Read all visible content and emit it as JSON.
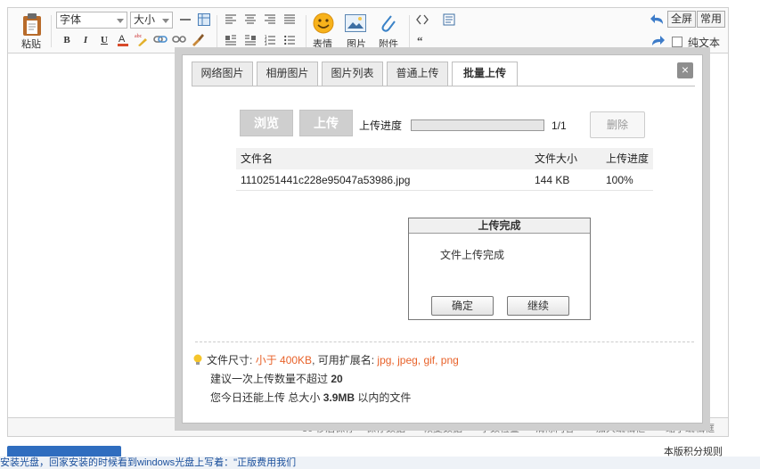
{
  "toolbar": {
    "paste": "粘贴",
    "font_select": "字体",
    "size_select": "大小",
    "emoji": "表情",
    "image": "图片",
    "attach": "附件",
    "fullscreen": "全屏",
    "common": "常用",
    "plaintext": "纯文本"
  },
  "statusbar": {
    "autosave": "30 秒后保存",
    "save_data": "保存数据",
    "restore_data": "恢复数据",
    "word_check": "字数检查",
    "clear": "清除内容",
    "enlarge": "加大编辑框",
    "shrink": "缩小编辑框"
  },
  "below": {
    "rules": "本版积分规则"
  },
  "ticker": "安装光盘，回家安装的时候看到windows光盘上写着：\"正版费用我们",
  "dialog": {
    "tabs": [
      "网络图片",
      "相册图片",
      "图片列表",
      "普通上传",
      "批量上传"
    ],
    "active_tab": 4,
    "close": "×",
    "browse": "浏览",
    "upload": "上传",
    "progress_label": "上传进度",
    "progress_value": 1.0,
    "progress_count": "1/1",
    "delete": "删除",
    "table": {
      "headers": [
        "文件名",
        "文件大小",
        "上传进度"
      ],
      "rows": [
        {
          "name": "1110251441c228e95047a53986.jpg",
          "size": "144 KB",
          "progress": "100%"
        }
      ]
    },
    "msgbox": {
      "title": "上传完成",
      "text": "文件上传完成",
      "ok": "确定",
      "continue": "继续"
    },
    "info": {
      "size_label": "文件尺寸:",
      "size_value": "小于 400KB",
      "ext_label": ", 可用扩展名:",
      "ext_value": "jpg, jpeg, gif, png",
      "limit_text": "建议一次上传数量不超过",
      "limit_value": "20",
      "today_prefix": "您今日还能上传 总大小",
      "today_value": "3.9MB",
      "today_suffix": "以内的文件"
    }
  },
  "colors": {
    "highlight": "#e8622a",
    "blue": "#2f6dbf"
  }
}
